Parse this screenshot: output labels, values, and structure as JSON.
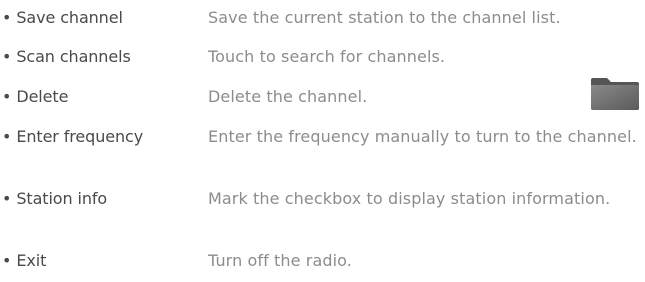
{
  "items": [
    {
      "term": "Save channel",
      "description": "Save the current station to the channel list."
    },
    {
      "term": "Scan channels",
      "description": "Touch to search for channels."
    },
    {
      "term": "Delete",
      "description": "Delete the channel."
    },
    {
      "term": "Enter frequency",
      "description": "Enter the frequency manually to turn to the channel."
    },
    {
      "term": "Station info",
      "description": "Mark the checkbox to display station information."
    },
    {
      "term": "Exit",
      "description": "Turn off the radio."
    }
  ],
  "bullet": "•",
  "icons": {
    "folder": "folder-icon"
  }
}
